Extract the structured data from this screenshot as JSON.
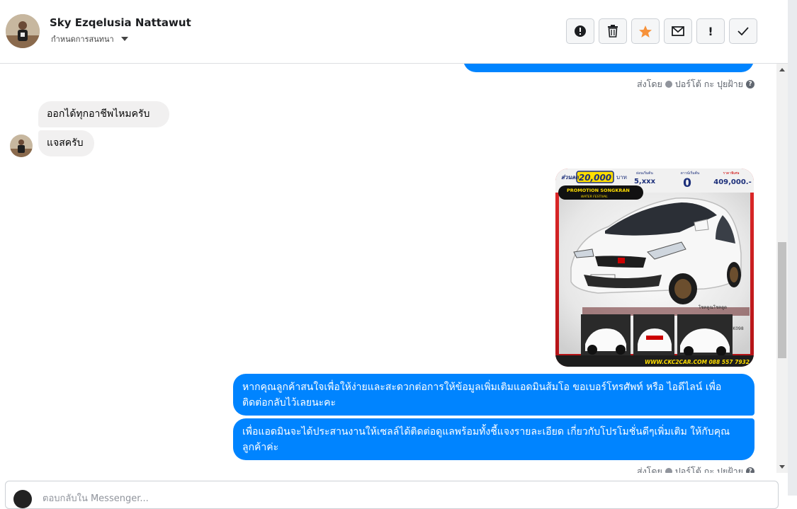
{
  "header": {
    "name": "Sky Ezqelusia Nattawut",
    "subtitle": "กำหนดการสนทนา",
    "actions": [
      {
        "icon": "alert-circle-icon"
      },
      {
        "icon": "trash-icon"
      },
      {
        "icon": "star-icon",
        "color": "#f7923b"
      },
      {
        "icon": "envelope-icon"
      },
      {
        "icon": "exclamation-icon",
        "label": "!"
      },
      {
        "icon": "checkmark-icon"
      }
    ]
  },
  "thread": {
    "sent_by_top": {
      "prefix": "ส่งโดย",
      "agent": "ปอร์โต้ กะ ปุยฝ้าย",
      "help": "?"
    },
    "incoming": [
      {
        "text": "ออกได้ทุกอาชีพไหมครับ"
      },
      {
        "text": "แจสครับ"
      }
    ],
    "image": {
      "discount_label": "ส่วนลด",
      "discount_value": "20,000",
      "discount_unit": "บาท",
      "installment_label": "ผ่อนเริ่มต้น",
      "installment_value": "5,xxx",
      "down_label": "ดาวน์เริ่มต้น",
      "down_value": "0",
      "price_label": "ราคาพิเศษ",
      "price_value": "409,000.-",
      "promo_line1": "PROMOTION SONGKRAN",
      "promo_line2": "WATER FESTIVAL",
      "dealer_label": "โชคคูณโชคดูด",
      "stock_code": "K098",
      "website": "WWW.CKC2CAR.COM 088 557 7932",
      "colors": {
        "frame": "#d71e25",
        "accent": "#ffde00"
      }
    },
    "outgoing": [
      {
        "text": "หากคุณลูกค้าสนใจเพื่อให้ง่ายและสะดวกต่อการให้ข้อมูลเพิ่มเติมแอดมินส้มโอ ขอเบอร์โทรศัพท์ หรือ ไอดีไลน์ เพื่อติดต่อกลับไว้เลยนะคะ"
      },
      {
        "text": "เพื่อแอดมินจะได้ประสานงานให้เซลล์ได้ติดต่อดูแลพร้อมทั้งชี้แจงรายละเอียด เกี่ยวกับโปรโมชั่นดีๆเพิ่มเติม ให้กับคุณลูกค้าค่ะ"
      }
    ],
    "sent_by_bottom": {
      "prefix": "ส่งโดย",
      "agent": "ปอร์โต้ กะ ปุยฝ้าย",
      "help": "?"
    }
  },
  "composer": {
    "placeholder": "ตอบกลับใน Messenger..."
  },
  "colors": {
    "accent": "#0084ff",
    "incoming_bg": "#f1f0f0"
  }
}
